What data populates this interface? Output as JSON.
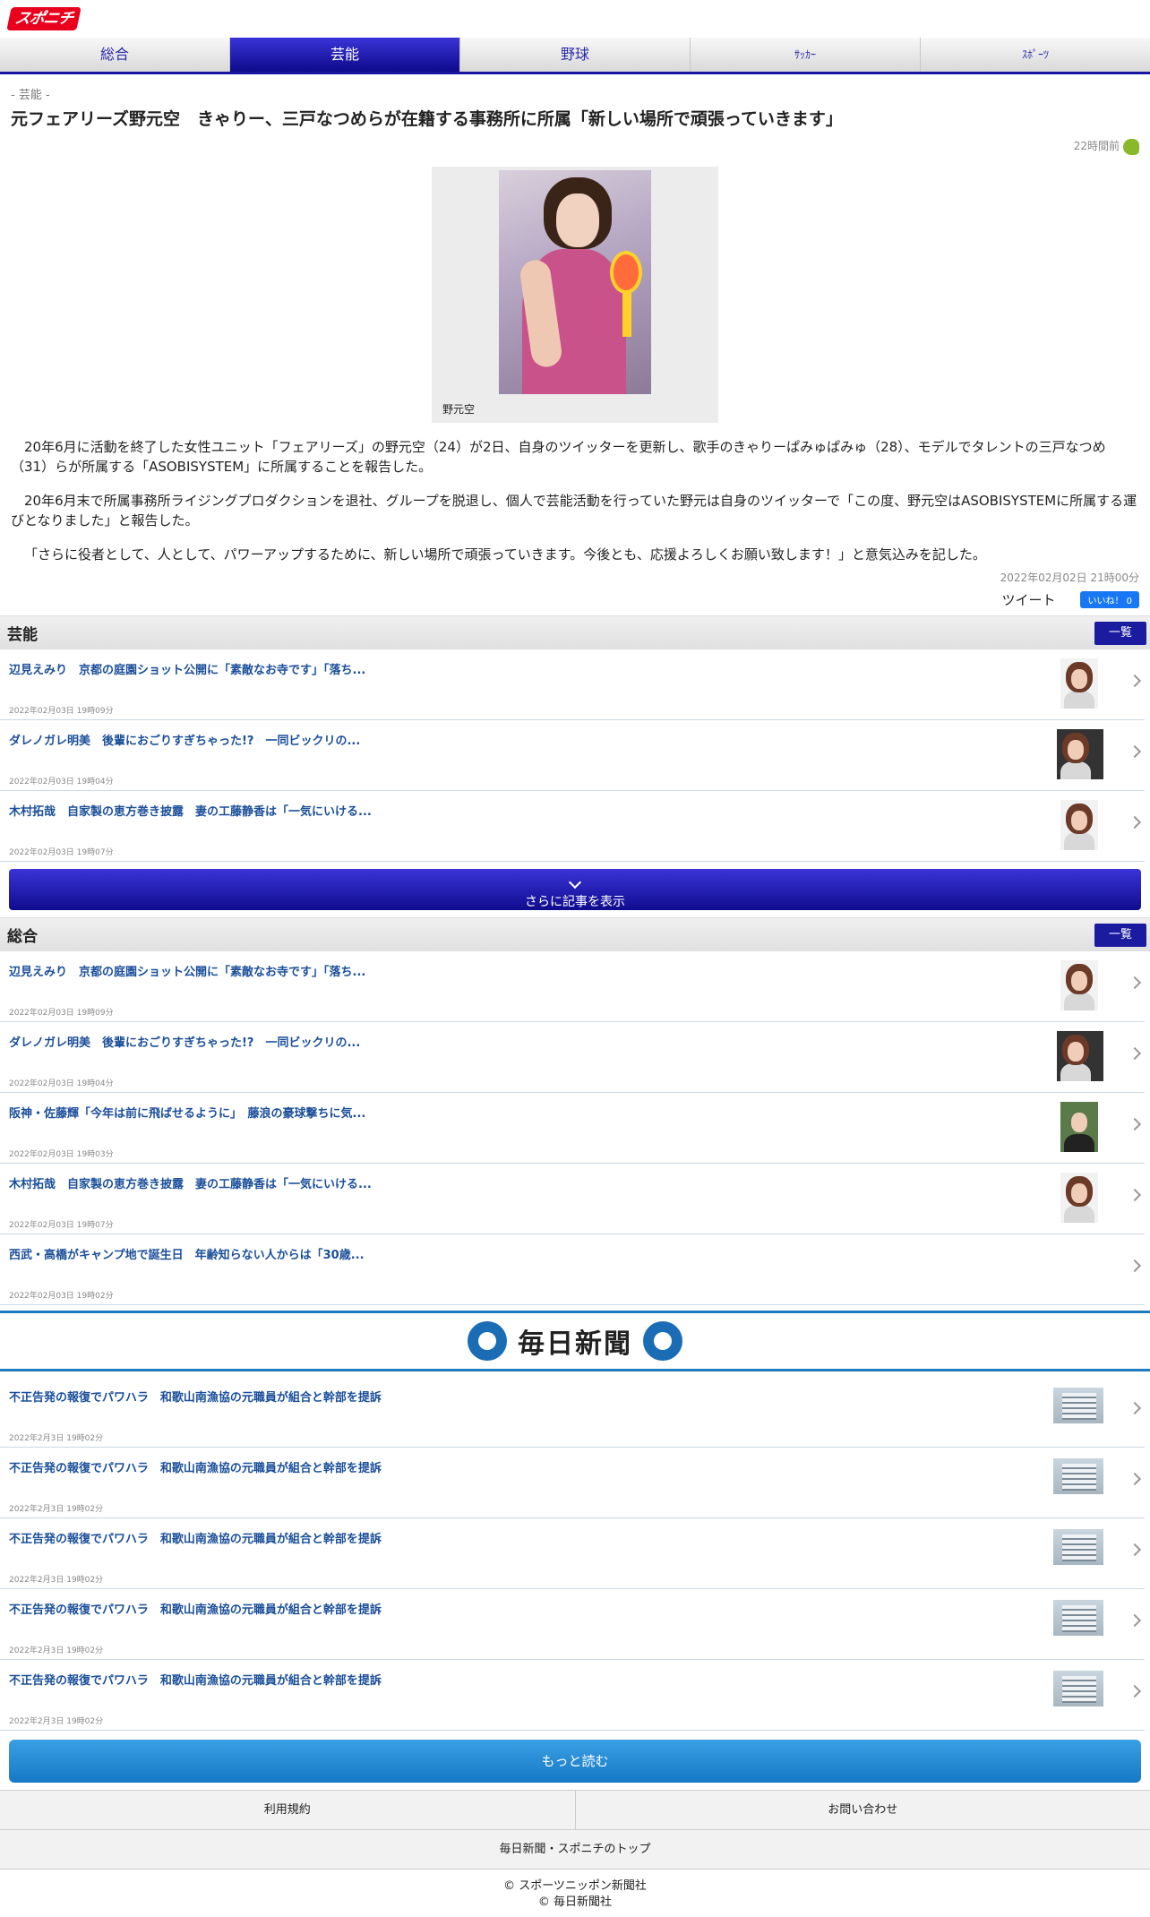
{
  "brand": {
    "logo_text": "スポニチ",
    "logo_color": "#e8001c",
    "accent": "#1a18a0"
  },
  "nav": {
    "tabs": [
      {
        "label": "総合",
        "active": false
      },
      {
        "label": "芸能",
        "active": true
      },
      {
        "label": "野球",
        "active": false
      },
      {
        "label": "ｻｯｶｰ",
        "active": false
      },
      {
        "label": "ｽﾎﾟｰﾂ",
        "active": false
      }
    ]
  },
  "article": {
    "breadcrumb": "- 芸能 -",
    "title": "元フェアリーズ野元空　きゃりー、三戸なつめらが在籍する事務所に所属「新しい場所で頑張っていきます」",
    "age": "22時間前",
    "photo_caption": "野元空",
    "paragraphs": [
      "20年6月に活動を終了した女性ユニット「フェアリーズ」の野元空（24）が2日、自身のツイッターを更新し、歌手のきゃりーぱみゅぱみゅ（28）、モデルでタレントの三戸なつめ（31）らが所属する「ASOBISYSTEM」に所属することを報告した。",
      "20年6月末で所属事務所ライジングプロダクションを退社、グループを脱退し、個人で芸能活動を行っていた野元は自身のツイッターで「この度、野元空はASOBISYSTEMに所属する運びとなりました」と報告した。",
      "「さらに役者として、人として、パワーアップするために、新しい場所で頑張っていきます。今後とも、応援よろしくお願い致します！」と意気込みを記した。"
    ],
    "published": "2022年02月02日 21時00分",
    "tweet_label": "ツイート",
    "like_label": "いいね！ 0"
  },
  "geino": {
    "title": "芸能",
    "list_button": "一覧",
    "items": [
      {
        "title": "辺見えみり　京都の庭園ショット公開に「素敵なお寺です」「落ち...",
        "date": "2022年02月03日 19時09分"
      },
      {
        "title": "ダレノガレ明美　後輩におごりすぎちゃった!?　一同ビックリの...",
        "date": "2022年02月03日 19時04分"
      },
      {
        "title": "木村拓哉　自家製の恵方巻き披露　妻の工藤静香は「一気にいける...",
        "date": "2022年02月03日 19時07分"
      }
    ],
    "more_label": "さらに記事を表示"
  },
  "sogo": {
    "title": "総合",
    "list_button": "一覧",
    "items": [
      {
        "title": "辺見えみり　京都の庭園ショット公開に「素敵なお寺です」「落ち...",
        "date": "2022年02月03日 19時09分"
      },
      {
        "title": "ダレノガレ明美　後輩におごりすぎちゃった!?　一同ビックリの...",
        "date": "2022年02月03日 19時04分"
      },
      {
        "title": "阪神・佐藤輝「今年は前に飛ばせるように」　藤浪の豪球撃ちに気...",
        "date": "2022年02月03日 19時03分"
      },
      {
        "title": "木村拓哉　自家製の恵方巻き披露　妻の工藤静香は「一気にいける...",
        "date": "2022年02月03日 19時07分"
      },
      {
        "title": "西武・高橋がキャンプ地で誕生日　年齢知らない人からは「30歳...",
        "date": "2022年02月03日 19時02分"
      }
    ]
  },
  "mainichi": {
    "logo_text": "毎日新聞",
    "items": [
      {
        "title": "不正告発の報復でパワハラ　和歌山南漁協の元職員が組合と幹部を提訴",
        "date": "2022年2月3日 19時02分"
      },
      {
        "title": "不正告発の報復でパワハラ　和歌山南漁協の元職員が組合と幹部を提訴",
        "date": "2022年2月3日 19時02分"
      },
      {
        "title": "不正告発の報復でパワハラ　和歌山南漁協の元職員が組合と幹部を提訴",
        "date": "2022年2月3日 19時02分"
      },
      {
        "title": "不正告発の報復でパワハラ　和歌山南漁協の元職員が組合と幹部を提訴",
        "date": "2022年2月3日 19時02分"
      },
      {
        "title": "不正告発の報復でパワハラ　和歌山南漁協の元職員が組合と幹部を提訴",
        "date": "2022年2月3日 19時02分"
      }
    ],
    "read_more": "もっと読む"
  },
  "footer": {
    "terms": "利用規約",
    "contact": "お問い合わせ",
    "top_link": "毎日新聞・スポニチのトップ",
    "copyright1": "© スポーツニッポン新聞社",
    "copyright2": "© 毎日新聞社"
  }
}
